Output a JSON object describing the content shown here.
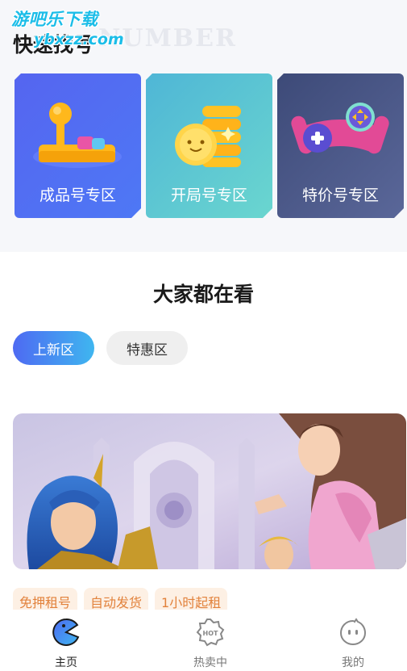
{
  "watermark": {
    "line1": "游吧乐下载",
    "line2": "ybxzz.com"
  },
  "quick_section": {
    "title": "快速找号",
    "bg_text": "NUMBER"
  },
  "zones": [
    {
      "label": "成品号专区",
      "icon": "joystick-icon"
    },
    {
      "label": "开局号专区",
      "icon": "coin-stack-icon"
    },
    {
      "label": "特价号专区",
      "icon": "gamepad-icon"
    }
  ],
  "watching": {
    "title": "大家都在看"
  },
  "tabs": [
    {
      "label": "上新区",
      "active": true
    },
    {
      "label": "特惠区",
      "active": false
    }
  ],
  "banner": {
    "description_icon": "game-hero-banner"
  },
  "tags": [
    "免押租号",
    "自动发货",
    "1小时起租"
  ],
  "bottom_nav": [
    {
      "label": "主页",
      "icon": "pacman-home-icon",
      "active": true
    },
    {
      "label": "热卖中",
      "icon": "hot-badge-icon",
      "active": false
    },
    {
      "label": "我的",
      "icon": "face-icon",
      "active": false
    }
  ],
  "colors": {
    "accent_blue": "#4e6af2",
    "accent_cyan": "#3fb6f0",
    "tag_text": "#e2823c",
    "tag_bg": "#fdf0e4"
  }
}
